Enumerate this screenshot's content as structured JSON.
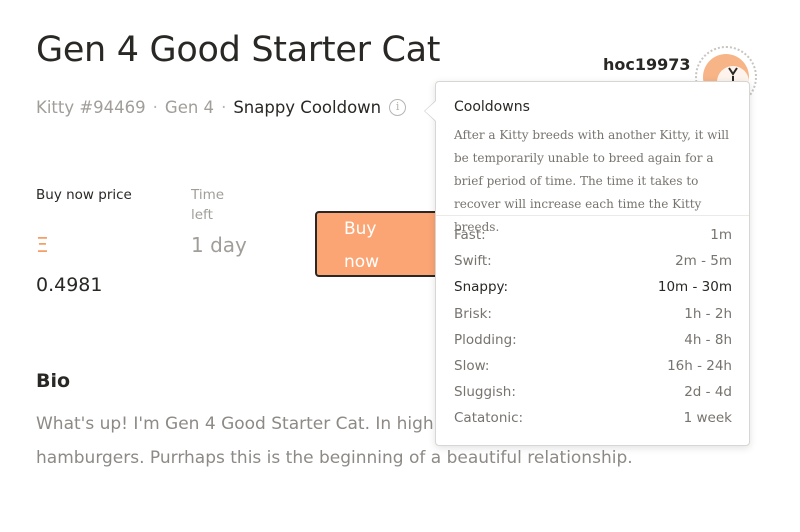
{
  "kitty": {
    "name": "Gen 4 Good Starter Cat",
    "id_label": "Kitty #94469",
    "generation": "Gen 4",
    "cooldown": "Snappy Cooldown",
    "info_icon": "i"
  },
  "owner": {
    "username": "hoc19973"
  },
  "sale": {
    "price_label": "Buy now price",
    "currency_symbol": "Ξ",
    "price": "0.4981",
    "time_label": "Time left",
    "time_value": "1 day",
    "buy_button_label": "Buy now"
  },
  "bio": {
    "heading": "Bio",
    "text": "What's up! I'm Gen 4 Good Starter Cat. In high s at NASA. My secret indulgence is hamburgers. Purrhaps this is the beginning of a beautiful relationship."
  },
  "cooldown_tooltip": {
    "title": "Cooldowns",
    "description": "After a Kitty breeds with another Kitty, it will be temporarily unable to breed again for a brief period of time. The time it takes to recover will increase each time the Kitty breeds.",
    "rows": [
      {
        "name": "Fast:",
        "duration": "1m",
        "active": false
      },
      {
        "name": "Swift:",
        "duration": "2m - 5m",
        "active": false
      },
      {
        "name": "Snappy:",
        "duration": "10m - 30m",
        "active": true
      },
      {
        "name": "Brisk:",
        "duration": "1h - 2h",
        "active": false
      },
      {
        "name": "Plodding:",
        "duration": "4h - 8h",
        "active": false
      },
      {
        "name": "Slow:",
        "duration": "16h - 24h",
        "active": false
      },
      {
        "name": "Sluggish:",
        "duration": "2d - 4d",
        "active": false
      },
      {
        "name": "Catatonic:",
        "duration": "1 week",
        "active": false
      }
    ]
  },
  "colors": {
    "accent": "#fba574",
    "eth_symbol": "#f79d67",
    "text_primary": "#2a2825",
    "text_muted": "#a19e99"
  }
}
